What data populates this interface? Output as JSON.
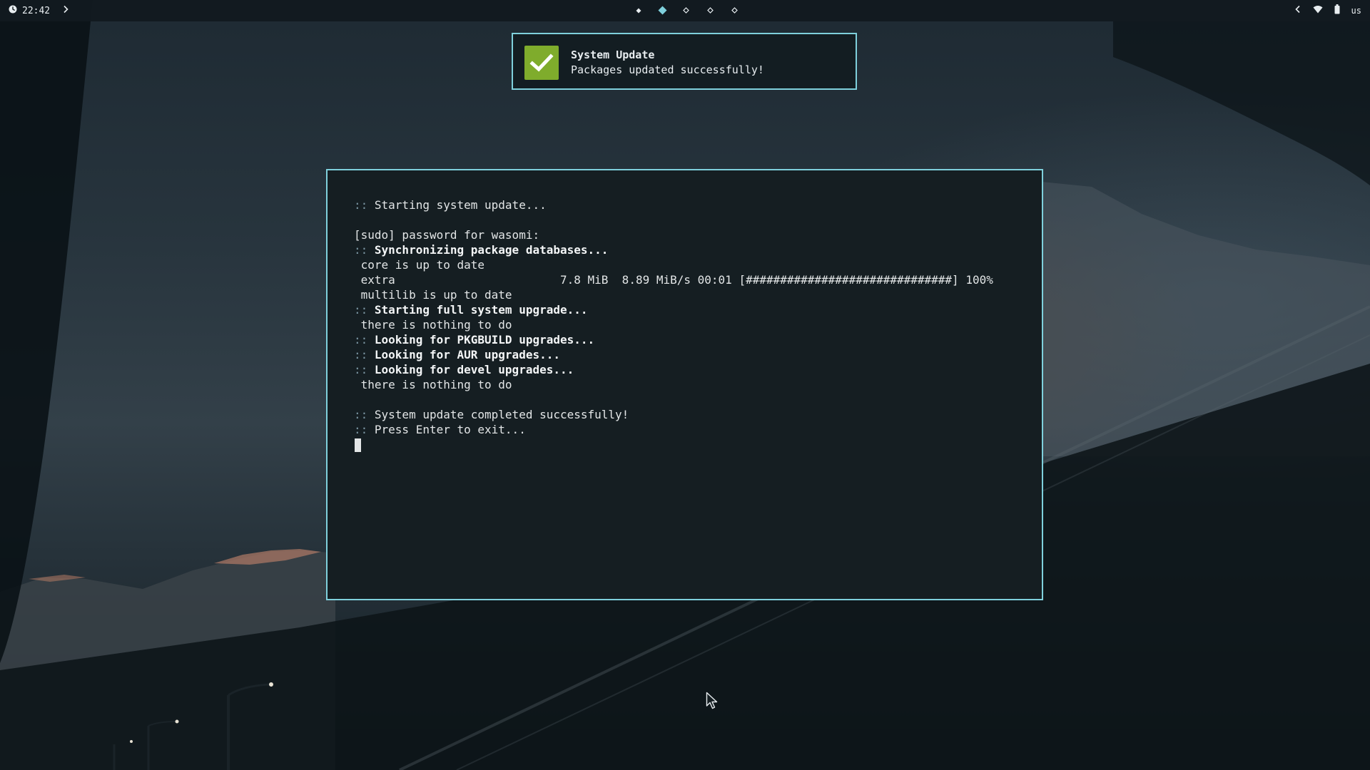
{
  "topbar": {
    "clock": "22:42",
    "keyboard_layout": "us",
    "workspaces": [
      {
        "index": 1,
        "state": "occupied"
      },
      {
        "index": 2,
        "state": "active"
      },
      {
        "index": 3,
        "state": "empty"
      },
      {
        "index": 4,
        "state": "empty"
      },
      {
        "index": 5,
        "state": "empty"
      }
    ],
    "icons": [
      "clock-icon",
      "chevron-right-icon",
      "chevron-left-icon",
      "wifi-icon",
      "battery-icon"
    ]
  },
  "notification": {
    "title": "System Update",
    "body": "Packages updated successfully!",
    "icon": "checkmark-icon",
    "icon_color": "#7fac2c",
    "border_color": "#7fd0dc"
  },
  "terminal": {
    "border_color": "#7fd0dc",
    "lines": [
      {
        "prefix": "::",
        "text": " Starting system update...",
        "bold": false
      },
      {
        "prefix": "",
        "text": "",
        "bold": false
      },
      {
        "prefix": "",
        "text": "[sudo] password for wasomi:",
        "bold": false
      },
      {
        "prefix": "::",
        "text": " Synchronizing package databases...",
        "bold": true
      },
      {
        "prefix": "",
        "text": " core is up to date",
        "bold": false
      },
      {
        "prefix": "",
        "text": " extra                        7.8 MiB  8.89 MiB/s 00:01 [##############################] 100%",
        "bold": false
      },
      {
        "prefix": "",
        "text": " multilib is up to date",
        "bold": false
      },
      {
        "prefix": "::",
        "text": " Starting full system upgrade...",
        "bold": true
      },
      {
        "prefix": "",
        "text": " there is nothing to do",
        "bold": false
      },
      {
        "prefix": "::",
        "text": " Looking for PKGBUILD upgrades...",
        "bold": true
      },
      {
        "prefix": "::",
        "text": " Looking for AUR upgrades...",
        "bold": true
      },
      {
        "prefix": "::",
        "text": " Looking for devel upgrades...",
        "bold": true
      },
      {
        "prefix": "",
        "text": " there is nothing to do",
        "bold": false
      },
      {
        "prefix": "",
        "text": "",
        "bold": false
      },
      {
        "prefix": "::",
        "text": " System update completed successfully!",
        "bold": false
      },
      {
        "prefix": "::",
        "text": " Press Enter to exit...",
        "bold": false
      }
    ]
  }
}
